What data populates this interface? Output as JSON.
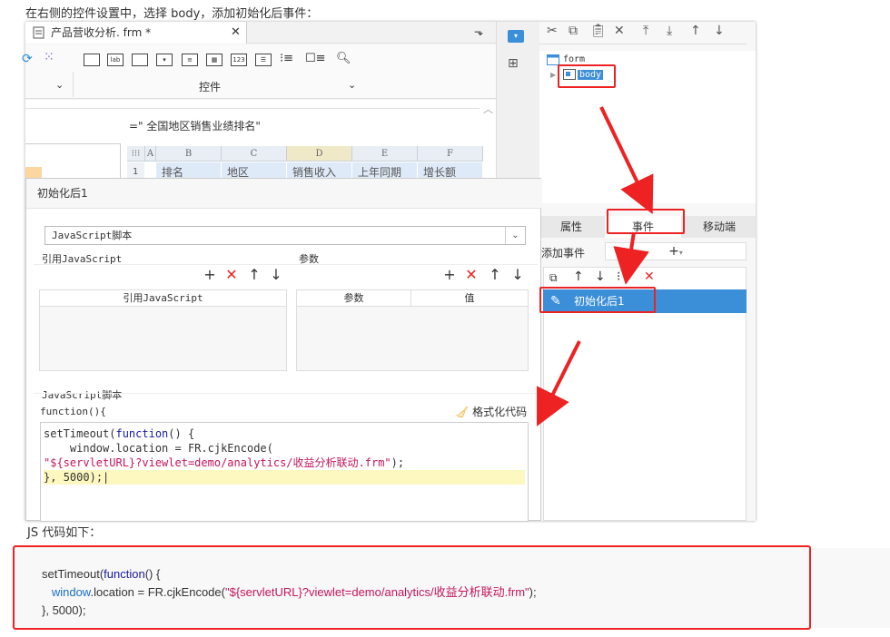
{
  "intro_text": "在右侧的控件设置中，选择 body，添加初始化后事件：",
  "designer": {
    "tab_title": "产品营收分析. frm *",
    "toolbar_group_label": "控件",
    "formula": "=\"  全国地区销售业绩排名\"",
    "col_headers": [
      "A",
      "B",
      "C",
      "D",
      "E",
      "F"
    ],
    "row_number": "1",
    "row_cells": [
      "排名",
      "地区",
      "销售收入",
      "上年同期",
      "增长额"
    ]
  },
  "tree": {
    "root": "form",
    "child": "body"
  },
  "props_tabs": [
    "属性",
    "事件",
    "移动端"
  ],
  "add_event_label": "添加事件",
  "event_item": "初始化后1",
  "dialog": {
    "title": "初始化后1",
    "script_type": "JavaScript脚本",
    "ref_js_label": "引用JavaScript",
    "params_label": "参数",
    "ref_js_header": "引用JavaScript",
    "param_col": "参数",
    "value_col": "值",
    "js_section_label": "JavaScript脚本",
    "function_sig": "function(){",
    "format_button": "格式化代码"
  },
  "code_lines": {
    "l1a": "setTimeout(",
    "l1b": "function",
    "l1c": "() {",
    "l2": "    window.location = FR.cjkEncode(",
    "l3": "\"${servletURL}?viewlet=demo/analytics/收益分析联动.frm\"",
    "l3b": ");",
    "l4a": "}, ",
    "l4b": "5000",
    "l4c": ");"
  },
  "bottom_caption": "JS 代码如下：",
  "bottom_code": {
    "l1a": "setTimeout(",
    "l1b": "function",
    "l1c": "() {",
    "l2a": "window",
    "l2b": ".location = FR.cjkEncode(",
    "l2c": "\"${servletURL}?viewlet=demo/analytics/收益分析联动.frm\"",
    "l2d": ");",
    "l3a": "}, ",
    "l3b": "5000",
    "l3c": ");"
  },
  "colors": {
    "accent": "#3b8ed8",
    "highlight_red": "#e22222",
    "code_keyword": "#1a1aa6",
    "code_string": "#c4165c"
  }
}
